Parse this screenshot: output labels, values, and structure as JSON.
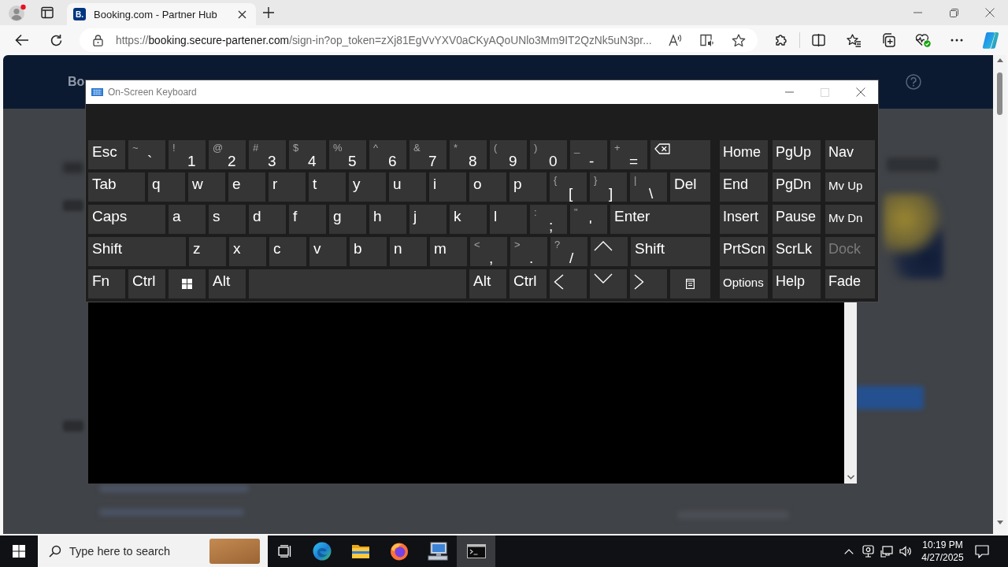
{
  "browser": {
    "tabs": [
      {
        "favicon": "B.",
        "title": "Booking.com - Partner Hub",
        "selected": true
      }
    ],
    "url": {
      "scheme": "https://",
      "host": "booking.secure-partener.com",
      "path": "/sign-in?op_token=zXj81EgVvYXV0aCKyAQoUNlo3Mm9IT2QzNk5uN3pr..."
    }
  },
  "page": {
    "header_logo": "Bo"
  },
  "keyboard": {
    "title": "On-Screen Keyboard",
    "controls": [
      {
        "kind": "minimize",
        "disabled": false
      },
      {
        "kind": "maximize",
        "disabled": true
      },
      {
        "kind": "close",
        "disabled": false
      }
    ],
    "rows": [
      [
        {
          "kind": "label",
          "label": "Esc"
        },
        {
          "kind": "symbol",
          "shift": "~",
          "base": "`"
        },
        {
          "kind": "symbol",
          "shift": "!",
          "base": "1"
        },
        {
          "kind": "symbol",
          "shift": "@",
          "base": "2"
        },
        {
          "kind": "symbol",
          "shift": "#",
          "base": "3"
        },
        {
          "kind": "symbol",
          "shift": "$",
          "base": "4"
        },
        {
          "kind": "symbol",
          "shift": "%",
          "base": "5"
        },
        {
          "kind": "symbol",
          "shift": "^",
          "base": "6"
        },
        {
          "kind": "symbol",
          "shift": "&",
          "base": "7"
        },
        {
          "kind": "symbol",
          "shift": "*",
          "base": "8"
        },
        {
          "kind": "symbol",
          "shift": "(",
          "base": "9"
        },
        {
          "kind": "symbol",
          "shift": ")",
          "base": "0"
        },
        {
          "kind": "symbol",
          "shift": "_",
          "base": "-"
        },
        {
          "kind": "symbol",
          "shift": "+",
          "base": "="
        },
        {
          "kind": "backspace"
        }
      ],
      [
        {
          "kind": "label",
          "label": "Tab"
        },
        {
          "kind": "label",
          "label": "q"
        },
        {
          "kind": "label",
          "label": "w"
        },
        {
          "kind": "label",
          "label": "e"
        },
        {
          "kind": "label",
          "label": "r"
        },
        {
          "kind": "label",
          "label": "t"
        },
        {
          "kind": "label",
          "label": "y"
        },
        {
          "kind": "label",
          "label": "u"
        },
        {
          "kind": "label",
          "label": "i"
        },
        {
          "kind": "label",
          "label": "o"
        },
        {
          "kind": "label",
          "label": "p"
        },
        {
          "kind": "symbol",
          "shift": "{",
          "base": "["
        },
        {
          "kind": "symbol",
          "shift": "}",
          "base": "]"
        },
        {
          "kind": "symbol",
          "shift": "|",
          "base": "\\"
        },
        {
          "kind": "label",
          "label": "Del"
        }
      ],
      [
        {
          "kind": "label",
          "label": "Caps"
        },
        {
          "kind": "label",
          "label": "a"
        },
        {
          "kind": "label",
          "label": "s"
        },
        {
          "kind": "label",
          "label": "d"
        },
        {
          "kind": "label",
          "label": "f"
        },
        {
          "kind": "label",
          "label": "g"
        },
        {
          "kind": "label",
          "label": "h"
        },
        {
          "kind": "label",
          "label": "j"
        },
        {
          "kind": "label",
          "label": "k"
        },
        {
          "kind": "label",
          "label": "l"
        },
        {
          "kind": "symbol",
          "shift": ":",
          "base": ";"
        },
        {
          "kind": "symbol",
          "shift": "\"",
          "base": "'"
        },
        {
          "kind": "label",
          "label": "Enter"
        }
      ],
      [
        {
          "kind": "label",
          "label": "Shift"
        },
        {
          "kind": "label",
          "label": "z"
        },
        {
          "kind": "label",
          "label": "x"
        },
        {
          "kind": "label",
          "label": "c"
        },
        {
          "kind": "label",
          "label": "v"
        },
        {
          "kind": "label",
          "label": "b"
        },
        {
          "kind": "label",
          "label": "n"
        },
        {
          "kind": "label",
          "label": "m"
        },
        {
          "kind": "symbol",
          "shift": "<",
          "base": ","
        },
        {
          "kind": "symbol",
          "shift": ">",
          "base": "."
        },
        {
          "kind": "symbol",
          "shift": "?",
          "base": "/"
        },
        {
          "kind": "up"
        },
        {
          "kind": "label",
          "label": "Shift"
        }
      ],
      [
        {
          "kind": "label",
          "label": "Fn"
        },
        {
          "kind": "label",
          "label": "Ctrl"
        },
        {
          "kind": "windows"
        },
        {
          "kind": "label",
          "label": "Alt"
        },
        {
          "kind": "space"
        },
        {
          "kind": "label",
          "label": "Alt"
        },
        {
          "kind": "label",
          "label": "Ctrl"
        },
        {
          "kind": "left"
        },
        {
          "kind": "down"
        },
        {
          "kind": "right"
        },
        {
          "kind": "menu"
        }
      ]
    ],
    "side_rows": [
      [
        {
          "kind": "label",
          "label": "Home",
          "disabled": false
        },
        {
          "kind": "label",
          "label": "PgUp",
          "disabled": false
        },
        {
          "kind": "label",
          "label": "Nav",
          "disabled": false
        }
      ],
      [
        {
          "kind": "label",
          "label": "End",
          "disabled": false
        },
        {
          "kind": "label",
          "label": "PgDn",
          "disabled": false
        },
        {
          "kind": "small-label",
          "label": "Mv Up",
          "disabled": false
        }
      ],
      [
        {
          "kind": "label",
          "label": "Insert",
          "disabled": false
        },
        {
          "kind": "label",
          "label": "Pause",
          "disabled": false
        },
        {
          "kind": "small-label",
          "label": "Mv Dn",
          "disabled": false
        }
      ],
      [
        {
          "kind": "label",
          "label": "PrtScn",
          "disabled": false
        },
        {
          "kind": "label",
          "label": "ScrLk",
          "disabled": false
        },
        {
          "kind": "label",
          "label": "Dock",
          "disabled": true
        }
      ],
      [
        {
          "kind": "small-label",
          "label": "Options",
          "disabled": false
        },
        {
          "kind": "label",
          "label": "Help",
          "disabled": false
        },
        {
          "kind": "label",
          "label": "Fade",
          "disabled": false
        }
      ]
    ]
  },
  "taskbar": {
    "search": {
      "placeholder": "Type here to search"
    },
    "apps": [
      {
        "kind": "edge",
        "active": false
      },
      {
        "kind": "explorer",
        "active": false
      },
      {
        "kind": "firefox",
        "active": false
      },
      {
        "kind": "computer",
        "active": false
      },
      {
        "kind": "terminal",
        "active": true
      }
    ],
    "clock": {
      "time": "10:19 PM",
      "date": "4/27/2025"
    }
  }
}
